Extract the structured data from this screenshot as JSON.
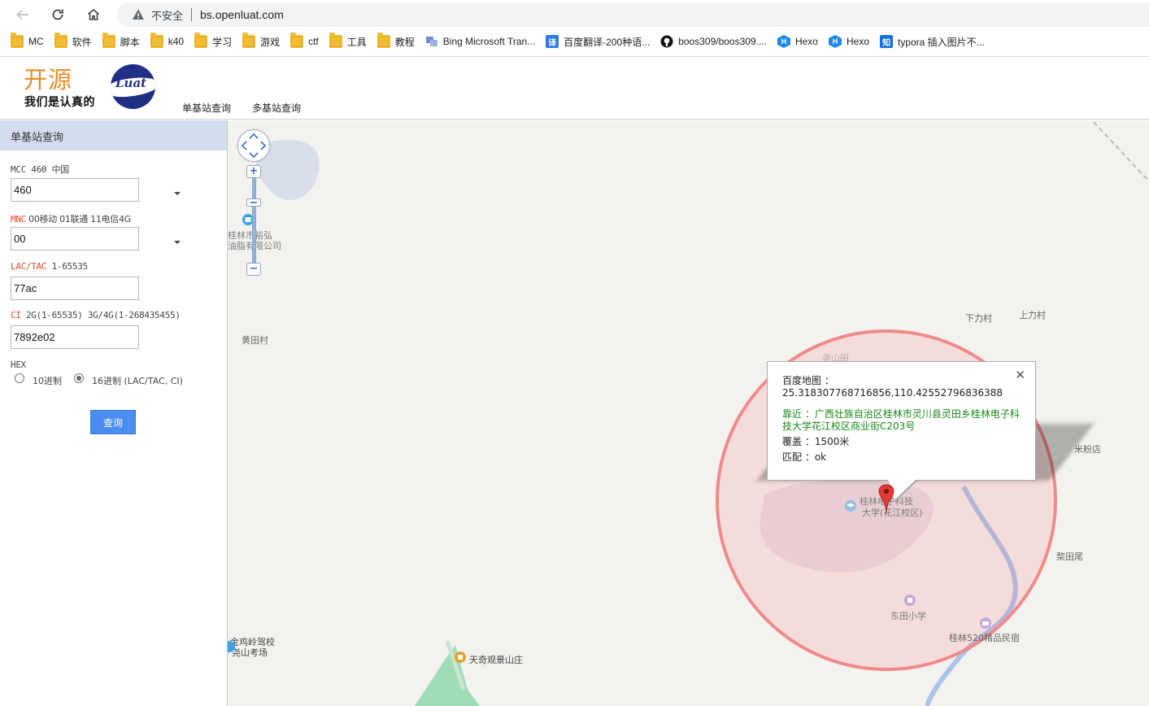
{
  "browser": {
    "insecure_label": "不安全",
    "url": "bs.openluat.com",
    "bookmarks": [
      {
        "label": "MC",
        "icon": "folder-icon"
      },
      {
        "label": "软件",
        "icon": "folder-icon"
      },
      {
        "label": "脚本",
        "icon": "folder-icon"
      },
      {
        "label": "k40",
        "icon": "folder-icon"
      },
      {
        "label": "学习",
        "icon": "folder-icon"
      },
      {
        "label": "游戏",
        "icon": "folder-icon"
      },
      {
        "label": "ctf",
        "icon": "folder-icon"
      },
      {
        "label": "工具",
        "icon": "folder-icon"
      },
      {
        "label": "教程",
        "icon": "folder-icon"
      },
      {
        "label": "Bing Microsoft Tran...",
        "icon": "bing-translator-icon"
      },
      {
        "label": "百度翻译-200种语...",
        "icon": "baidu-translate-icon"
      },
      {
        "label": "boos309/boos309....",
        "icon": "github-icon"
      },
      {
        "label": "Hexo",
        "icon": "hexo-icon"
      },
      {
        "label": "Hexo",
        "icon": "hexo-icon"
      },
      {
        "label": "typora 插入图片不...",
        "icon": "zhihu-icon"
      }
    ],
    "icons": {
      "translate_glyph": "译",
      "zhihu_glyph": "知",
      "hexo_glyph": "H"
    }
  },
  "header": {
    "logo_big": "开源",
    "logo_small": "我们是认真的",
    "logo_word": "Luat",
    "nav": [
      "单基站查询",
      "多基站查询"
    ],
    "brand_color": "#f08a24"
  },
  "form": {
    "title": "单基站查询",
    "mcc_label": "MCC 460 中国",
    "mcc_value": "460",
    "mnc_key": "MNC",
    "mnc_hint": " 00移动 01联通 11电信4G",
    "mnc_value": "00",
    "lac_key": "LAC/TAC",
    "lac_hint": " 1-65535",
    "lac_value": "77ac",
    "ci_key": "CI",
    "ci_hint": " 2G(1-65535) 3G/4G(1-268435455)",
    "ci_value": "7892e02",
    "hex_label": "HEX",
    "radio_dec": "10进制",
    "radio_hex": "16进制 (LAC/TAC, CI)",
    "selected_radix": "16进制",
    "submit": "查询"
  },
  "map": {
    "labels": {
      "poi_company_line1": "桂林市裕弘",
      "poi_company_line2": "油脂有限公司",
      "huangtian": "黄田村",
      "xialicun": "下力村",
      "shanglicun": "上力村",
      "yaoshantian": "尧山田",
      "mifendian": "米粉店",
      "litianwei": "棃田尾",
      "university_line1": "桂林电子科技",
      "university_line2": "大学(花江校区)",
      "dongtian_school": "东田小学",
      "guilin520": "桂林520精品民宿",
      "jinjiling_line1": "金鸡岭驾校",
      "jinjiling_line2": "尧山考场",
      "tianqi": "天奇观景山庄"
    },
    "info": {
      "coord_label": "百度地图 ：",
      "coords": "25.318307768716856,110.42552796836388",
      "near": "靠近 ：广西壮族自治区桂林市灵川县灵田乡桂林电子科技大学花江校区商业街C203号",
      "coverage": "覆盖 ：1500米",
      "match": "匹配 ：ok",
      "close": "✕"
    },
    "zoom_plus": "+",
    "zoom_minus": "−",
    "circle_color": "#f08080"
  }
}
